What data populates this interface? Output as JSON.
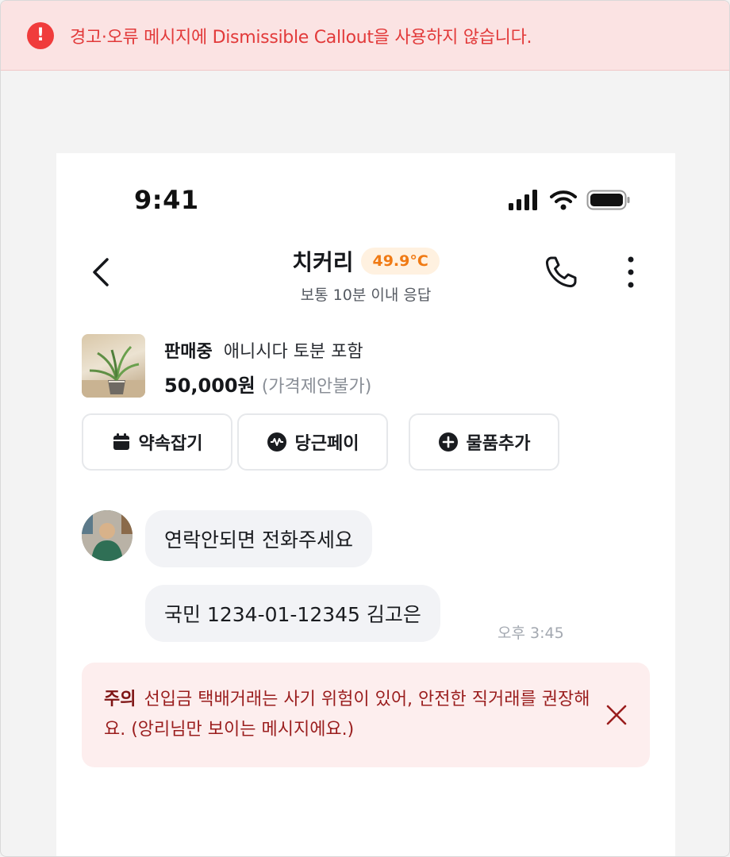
{
  "banner": {
    "icon": "alert-circle-icon",
    "text": "경고·오류 메시지에 Dismissible Callout을 사용하지 않습니다."
  },
  "status_bar": {
    "time": "9:41",
    "icons": [
      "signal-icon",
      "wifi-icon",
      "battery-icon"
    ]
  },
  "header": {
    "title": "치커리",
    "temperature": "49.9°C",
    "subtitle": "보통 10분 이내 응답",
    "icons": [
      "back-icon",
      "phone-icon",
      "more-vertical-icon"
    ]
  },
  "product": {
    "status": "판매중",
    "name": "애니시다 토분 포함",
    "price": "50,000원",
    "price_note": "(가격제안불가)"
  },
  "actions": [
    {
      "label": "약속잡기",
      "icon": "calendar-icon"
    },
    {
      "label": "당근페이",
      "icon": "pay-icon"
    },
    {
      "label": "물품추가",
      "icon": "plus-circle-icon"
    }
  ],
  "messages": [
    {
      "text": "연락안되면 전화주세요"
    },
    {
      "text": "국민 1234-01-12345 김고은",
      "time": "오후 3:45"
    }
  ],
  "callout": {
    "title": "주의",
    "body": "선입금 택배거래는 사기 위험이 있어, 안전한 직거래를 권장해요. (앙리님만 보이는 메시지에요.)",
    "close_icon": "close-icon"
  },
  "colors": {
    "banner_bg": "#fbe3e3",
    "banner_text": "#e23a3a",
    "temp_text": "#f07a14",
    "callout_bg": "#fdeeee",
    "callout_text": "#9a1d1d"
  }
}
